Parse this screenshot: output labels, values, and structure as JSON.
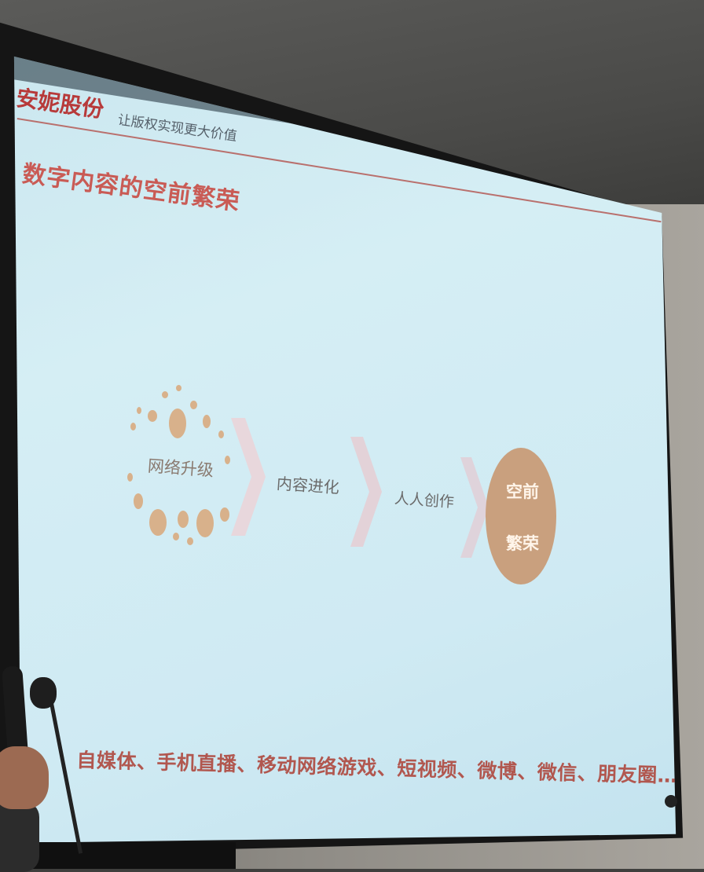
{
  "header": {
    "logo_text": "安妮股份",
    "slogan": "让版权实现更大价值"
  },
  "slide": {
    "title": "数字内容的空前繁荣",
    "steps": [
      {
        "label": "网络升级"
      },
      {
        "label": "内容进化"
      },
      {
        "label": "人人创作"
      }
    ],
    "final": {
      "line1": "空前",
      "line2": "繁荣"
    },
    "bottom_text": "自媒体、手机直播、移动网络游戏、短视频、微博、微信、朋友圈……"
  },
  "colors": {
    "title_red": "#c95b55",
    "dot_tan": "#d8b18b",
    "circle_tan": "#c9a07e",
    "chevron": "#e3d2d8"
  }
}
